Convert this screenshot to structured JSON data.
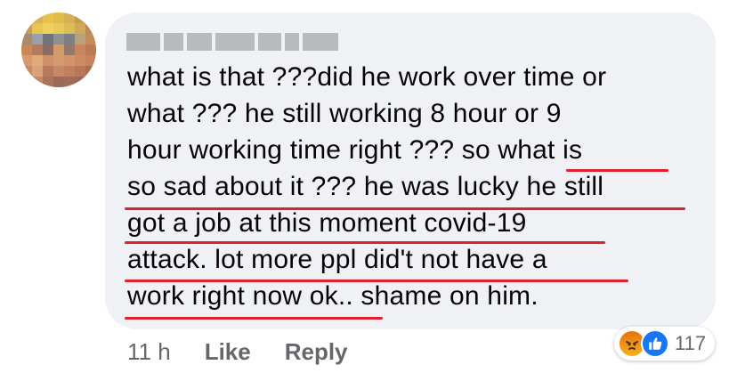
{
  "author": {
    "name_redacted": true
  },
  "comment": {
    "lines": [
      "what is that ???did he work over time or",
      "what ??? he still working 8 hour or 9",
      "hour working time right ??? so what is",
      "so sad about it ??? he was lucky he still",
      "got a job at this moment covid-19",
      "attack. lot more ppl did't not have a",
      "work right now ok.. shame on him."
    ]
  },
  "meta": {
    "time": "11 h",
    "like_label": "Like",
    "reply_label": "Reply"
  },
  "reactions": {
    "icons": [
      "angry-icon",
      "like-icon"
    ],
    "count": "117"
  },
  "colors": {
    "bubble": "#eff1f4",
    "underline": "#e0202c",
    "like_blue": "#1877f2",
    "meta_gray": "#65676b"
  }
}
